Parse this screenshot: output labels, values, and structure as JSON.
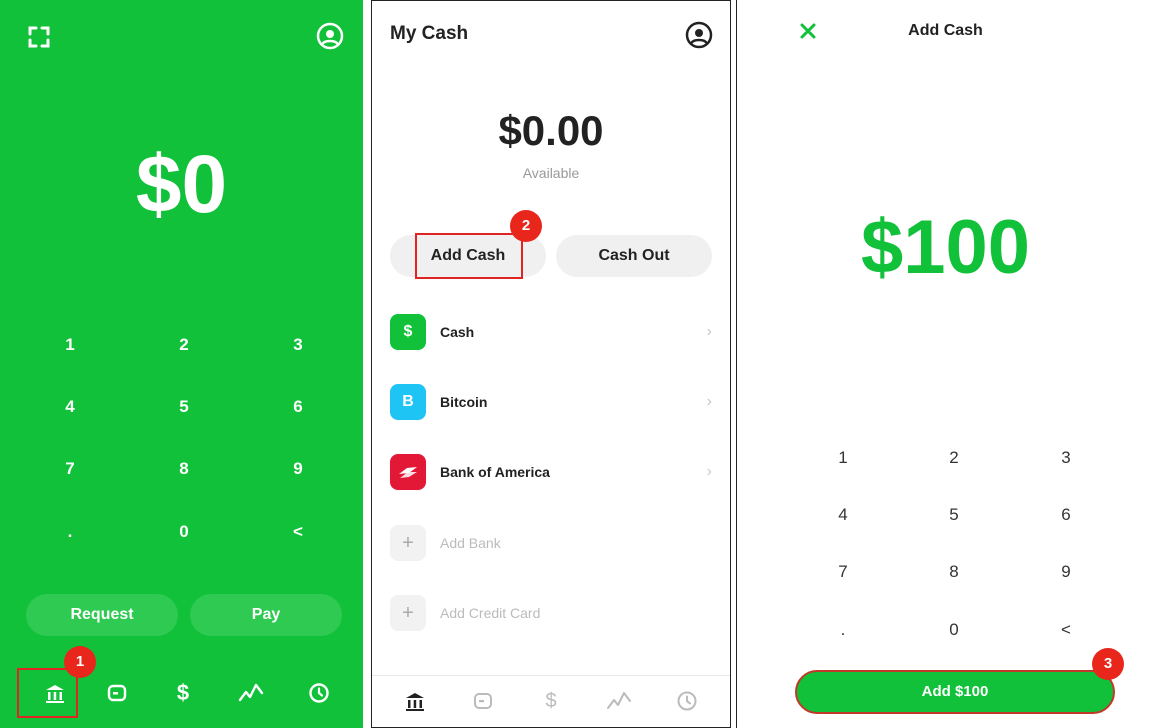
{
  "screen1": {
    "amount": "$0",
    "keys": [
      "1",
      "2",
      "3",
      "4",
      "5",
      "6",
      "7",
      "8",
      "9",
      ".",
      "0",
      "<"
    ],
    "request_label": "Request",
    "pay_label": "Pay",
    "badge": "1",
    "nav_icons": [
      "bank-icon",
      "card-icon",
      "dollar-icon",
      "activity-chart-icon",
      "clock-icon"
    ]
  },
  "screen2": {
    "title": "My Cash",
    "amount": "$0.00",
    "available_label": "Available",
    "add_cash_label": "Add Cash",
    "cash_out_label": "Cash Out",
    "badge": "2",
    "rows": [
      {
        "label": "Cash",
        "icon_text": "$",
        "color": "#11c13a"
      },
      {
        "label": "Bitcoin",
        "icon_text": "B",
        "color": "#1ec4f4"
      },
      {
        "label": "Bank of America",
        "icon_text": "",
        "color": "#e31837"
      },
      {
        "label": "Add Bank",
        "icon_text": "+",
        "color": "#f2f2f2"
      },
      {
        "label": "Add Credit Card",
        "icon_text": "+",
        "color": "#f2f2f2"
      }
    ],
    "nav_icons": [
      "bank-icon",
      "card-icon",
      "dollar-icon",
      "activity-chart-icon",
      "clock-icon"
    ]
  },
  "screen3": {
    "title": "Add Cash",
    "amount": "$100",
    "keys": [
      "1",
      "2",
      "3",
      "4",
      "5",
      "6",
      "7",
      "8",
      "9",
      ".",
      "0",
      "<"
    ],
    "button_label": "Add $100",
    "badge": "3"
  },
  "colors": {
    "brand_green": "#11c13a",
    "annotation_red": "#e8261c"
  }
}
